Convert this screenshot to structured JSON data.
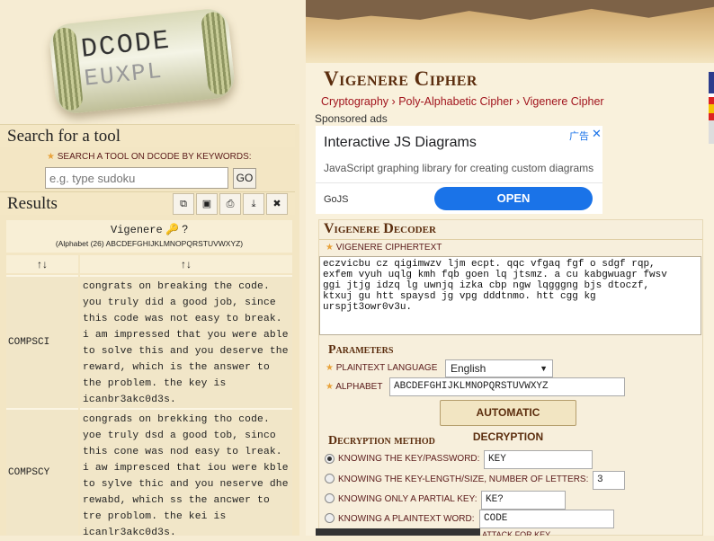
{
  "logo": {
    "row1": "DCODE",
    "row2": "EUXPL"
  },
  "search": {
    "title": "Search for a tool",
    "label": "SEARCH A TOOL ON DCODE BY KEYWORDS:",
    "placeholder": "e.g. type sudoku",
    "go": "GO"
  },
  "results": {
    "title": "Results",
    "tool_name": "Vigenere",
    "help": "?",
    "alphabet_note": "(Alphabet (26) ABCDEFGHIJKLMNOPQRSTUVWXYZ)",
    "sort_symbol": "↑↓",
    "rows": [
      {
        "key": "COMPSCI",
        "text": "congrats on breaking the code. you truly did a good job, since this code was not easy to break. i am impressed that you were able to solve this and you deserve the reward, which is the answer to the problem. the key is icanbr3akc0d3s."
      },
      {
        "key": "COMPSCY",
        "text": "congrads on brekking tho code. yoe truly dsd a good tob, sinco this cone was nod easy to lreak. i aw impresced that iou were kble to sylve thic and you neserve dhe rewabd, which ss the ancwer to tre problom. the kei is icanlr3akc0d3s."
      }
    ]
  },
  "page": {
    "title": "Vigenere Cipher",
    "breadcrumb": [
      "Cryptography",
      "Poly-Alphabetic Cipher",
      "Vigenere Cipher"
    ],
    "breadcrumb_sep": "›",
    "sponsored": "Sponsored ads"
  },
  "ad": {
    "title": "Interactive JS Diagrams",
    "desc": "JavaScript graphing library for creating custom diagrams",
    "brand": "GoJS",
    "cta": "OPEN",
    "ad_choice": "广告",
    "close": "✕"
  },
  "decoder": {
    "title": "Vigenere Decoder",
    "ciphertext_label": "VIGENERE CIPHERTEXT",
    "ciphertext": "eczvicbu cz qigimwzv ljm ecpt. qqc vfgaq fgf o sdgf rqp,\nexfem vyuh uqlg kmh fqb goen lq jtsmz. a cu kabgwuagr fwsv\nggi jtjg idzq lg uwnjq izka cbp ngw lqgggng bjs dtoczf,\nktxuj gu htt spaysd jg vpg dddtnmo. htt cgg kg\nurspjt3owr0v3u.",
    "params_title": "Parameters",
    "lang_label": "PLAINTEXT LANGUAGE",
    "lang_value": "English",
    "alphabet_label": "ALPHABET",
    "alphabet_value": "ABCDEFGHIJKLMNOPQRSTUVWXYZ",
    "auto_button": "AUTOMATIC DECRYPTION",
    "method_title": "Decryption method",
    "methods": [
      {
        "label": "KNOWING THE KEY/PASSWORD:",
        "value": "KEY"
      },
      {
        "label": "KNOWING THE KEY-LENGTH/SIZE, NUMBER OF LETTERS:",
        "value": "3"
      },
      {
        "label": "KNOWING ONLY A PARTIAL KEY:",
        "value": "KE?"
      },
      {
        "label": "KNOWING A PLAINTEXT WORD:",
        "value": "CODE"
      }
    ],
    "cut_text": "ATTACK FOR KEY"
  },
  "colors": {
    "title": "#5b2d0e",
    "link": "#a1141d",
    "accent": "#1a73e8"
  }
}
